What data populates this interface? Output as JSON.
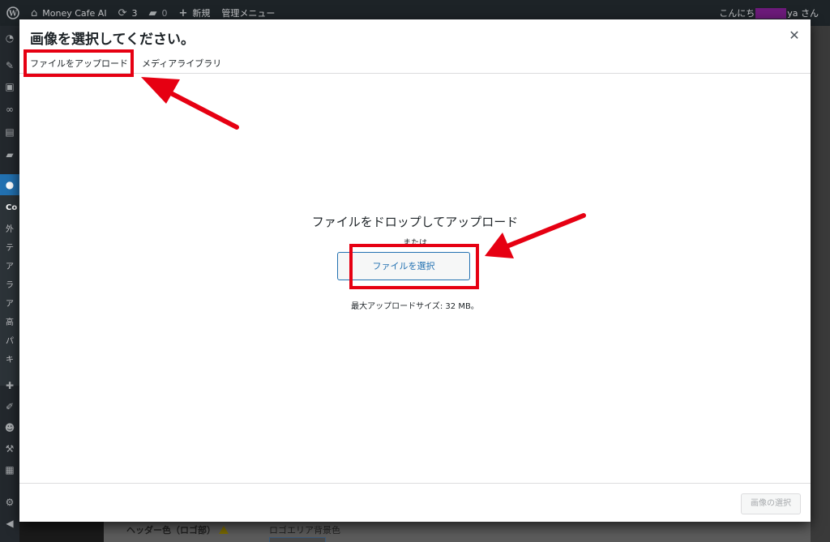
{
  "adminbar": {
    "site_name": "Money Cafe AI",
    "updates_count": "3",
    "comments_count": "0",
    "new_label": "新規",
    "manage_menu": "管理メニュー",
    "greeting_prefix": "こんにち",
    "greeting_suffix": "ya さん",
    "icons": [
      "wordpress-logo-icon",
      "home-icon",
      "updates-icon",
      "comments-icon",
      "plus-icon"
    ]
  },
  "adminmenu": {
    "section_label": "Co",
    "sub_items": [
      "外",
      "テ",
      "ア",
      "ラ",
      "ア",
      "高",
      "パ",
      "キ"
    ]
  },
  "modal": {
    "title": "画像を選択してください。",
    "close_icon": "close-icon",
    "tabs": [
      {
        "label": "ファイルをアップロード",
        "active": true
      },
      {
        "label": "メディアライブラリ",
        "active": false
      }
    ],
    "uploader": {
      "drop_text": "ファイルをドロップしてアップロード",
      "or_text": "または",
      "select_button": "ファイルを選択",
      "max_size": "最大アップロードサイズ: 32 MB。"
    },
    "footer": {
      "select_image_button": "画像の選択"
    }
  },
  "background_page": {
    "header_color_label": "ヘッダー色（ロゴ部）",
    "logo_area_bg_label": "ロゴエリア背景色"
  },
  "colors": {
    "annotation_red": "#e60012",
    "primary_blue": "#2271b1",
    "adminbar_bg": "#1d2327"
  }
}
